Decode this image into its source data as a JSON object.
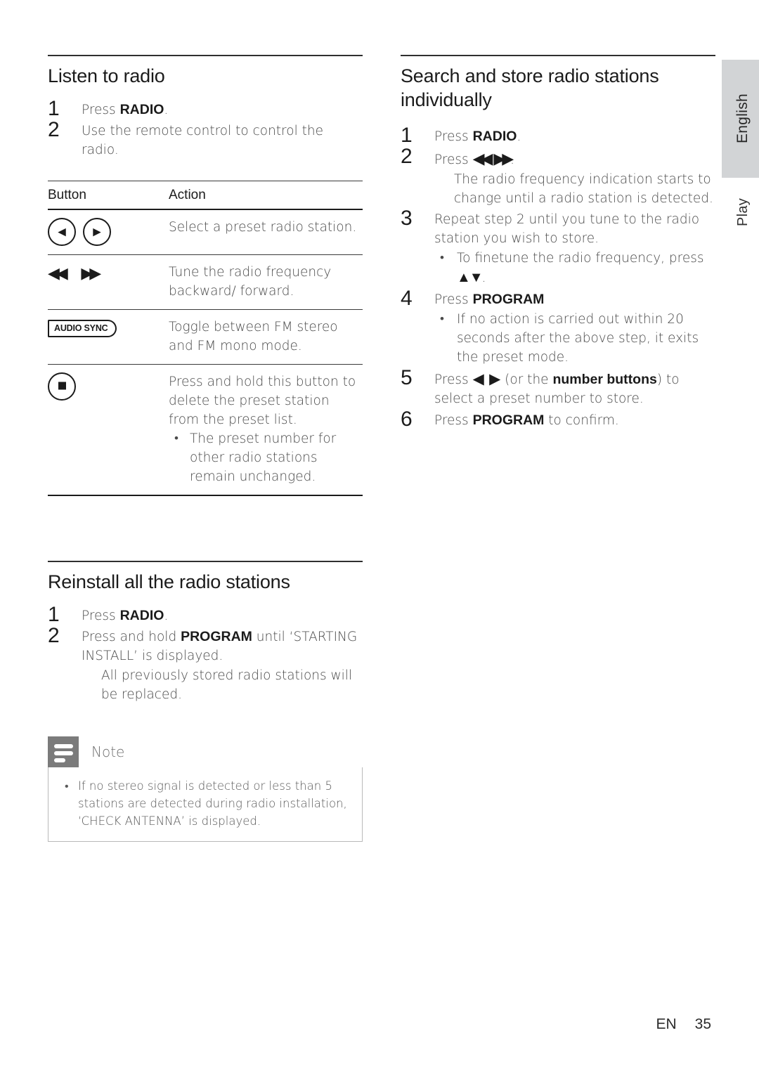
{
  "page": {
    "footer_label": "EN",
    "footer_page_number": "35",
    "side_tab_language": "English",
    "side_tab_chapter": "Play"
  },
  "left_column": {
    "listen_section": {
      "title": "Listen to radio",
      "steps": [
        {
          "num": "1",
          "pre": "Press ",
          "bold": "RADIO",
          "post": "."
        },
        {
          "num": "2",
          "pre": "Use the remote control to control the radio.",
          "bold": "",
          "post": ""
        }
      ]
    },
    "button_table": {
      "headers": {
        "col1": "Button",
        "col2": "Action"
      },
      "rows": [
        {
          "icon_kind": "preset-buttons",
          "icons": [
            "previous-track-icon",
            "next-track-icon"
          ],
          "glyph_prev": "◀",
          "glyph_next": "▶",
          "action": "Select a preset radio station.",
          "sub_bullets": []
        },
        {
          "icon_kind": "tune-arrows",
          "icons": [
            "rewind-icon",
            "fast-forward-icon"
          ],
          "glyph_rewind": "◀◀",
          "glyph_forward": "▶▶",
          "action": "Tune the radio frequency backward/ forward.",
          "sub_bullets": []
        },
        {
          "icon_kind": "audio-sync",
          "label": "AUDIO SYNC",
          "action": "Toggle between FM stereo and FM mono mode.",
          "sub_bullets": []
        },
        {
          "icon_kind": "stop-button",
          "icons": [
            "stop-icon"
          ],
          "action": "Press and hold this button to delete the preset station from the preset list.",
          "sub_bullets": [
            "The preset number for other radio stations remain unchanged."
          ]
        }
      ]
    },
    "reinstall_section": {
      "title": "Reinstall all the radio stations",
      "steps": [
        {
          "num": "1",
          "pre": "Press ",
          "bold": "RADIO",
          "post": "."
        },
        {
          "num": "2",
          "pre": "Press and hold ",
          "bold": "PROGRAM",
          "post": " until ‘STARTING INSTALL’ is displayed."
        }
      ],
      "sub_note": "All previously stored radio stations will be replaced."
    },
    "note_box": {
      "title": "Note",
      "items": [
        "If no stereo signal is detected or less than 5 stations are detected during radio installation, ‘CHECK ANTENNA’ is displayed."
      ]
    }
  },
  "right_column": {
    "search_section": {
      "title": "Search and store radio stations individually",
      "step1": {
        "num": "1",
        "pre": "Press ",
        "bold": "RADIO",
        "post": "."
      },
      "step2": {
        "num": "2",
        "pre": "Press ",
        "glyph_rewind": "◀◀",
        "glyph_forward": "▶▶",
        "post": ".",
        "sub_note": "The radio frequency indication starts to change until a radio station is detected."
      },
      "step3": {
        "num": "3",
        "text": "Repeat step 2 until you tune to the radio station you wish to store.",
        "bullet_pre": "To finetune the radio frequency, press ",
        "bullet_glyph": "▲▼",
        "bullet_post": "."
      },
      "step4": {
        "num": "4",
        "pre": "Press ",
        "bold": "PROGRAM",
        "post": "",
        "bullet": "If no action is carried out within 20 seconds after the above step, it exits the preset mode."
      },
      "step5": {
        "num": "5",
        "pre": "Press ",
        "glyph_prev": "◀",
        "glyph_next": "▶",
        "mid": " (or the ",
        "bold": "number buttons",
        "post": ") to select a preset number to store."
      },
      "step6": {
        "num": "6",
        "pre": "Press ",
        "bold": "PROGRAM",
        "post": " to confirm."
      }
    }
  }
}
